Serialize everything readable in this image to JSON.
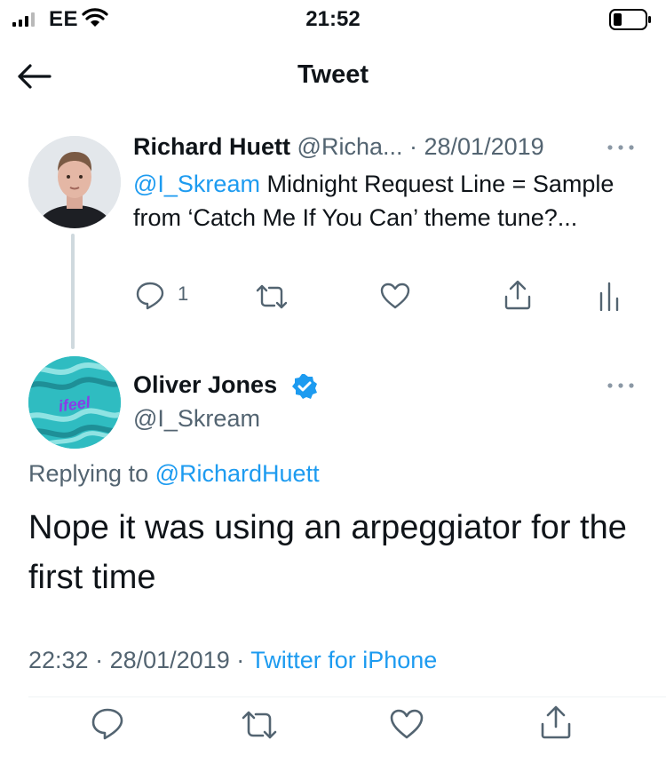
{
  "status_bar": {
    "carrier": "EE",
    "time": "21:52"
  },
  "nav": {
    "title": "Tweet"
  },
  "parent_tweet": {
    "name": "Richard Huett",
    "handle": "@Richa...",
    "date": "· 28/01/2019",
    "mention": "@I_Skream",
    "text": " Midnight Request Line = Sample from ‘Catch Me If You Can’ theme tune?...",
    "reply_count": "1"
  },
  "reply_tweet": {
    "name": "Oliver Jones",
    "handle": "@I_Skream",
    "replying_prefix": "Replying to ",
    "replying_to": "@RichardHuett",
    "text": "Nope it was using an arpeggiator for the first time",
    "time": "22:32",
    "date": "· 28/01/2019 ·",
    "source": "Twitter for iPhone",
    "avatar_text": "ifeel"
  },
  "colors": {
    "accent": "#1d9bf0",
    "secondary_text": "#536471",
    "verified": "#1d9bf0",
    "avatar_teal": "#31bfc4",
    "avatar_purple": "#8a3ce8"
  }
}
